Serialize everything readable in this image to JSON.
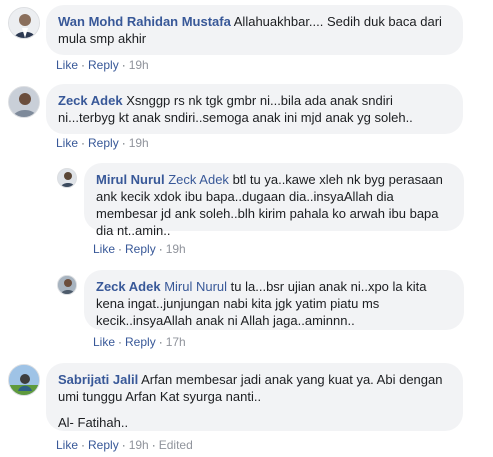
{
  "comments": [
    {
      "author": "Wan Mohd Rahidan Mustafa",
      "text": "Allahuakhbar.... Sedih duk baca dari mula smp akhir",
      "like": "Like",
      "reply": "Reply",
      "time": "19h"
    },
    {
      "author": "Zeck Adek",
      "text": "Xsnggp rs nk tgk gmbr ni...bila ada anak sndiri ni...terbyg kt anak sndiri..semoga anak ini mjd anak yg soleh..",
      "like": "Like",
      "reply": "Reply",
      "time": "19h"
    },
    {
      "author": "Mirul Nurul",
      "mention": "Zeck Adek",
      "text": "btl tu ya..kawe xleh nk byg perasaan ank kecik xdok ibu bapa..dugaan dia..insyaAllah dia membesar jd ank soleh..blh kirim pahala ko arwah ibu bapa dia nt..amin..",
      "like": "Like",
      "reply": "Reply",
      "time": "19h"
    },
    {
      "author": "Zeck Adek",
      "mention": "Mirul Nurul",
      "text": "tu la...bsr ujian anak ni..xpo la kita kena ingat..junjungan nabi kita jgk yatim piatu ms kecik..insyaAllah anak ni Allah jaga..aminnn..",
      "like": "Like",
      "reply": "Reply",
      "time": "17h"
    },
    {
      "author": "Sabrijati Jalil",
      "text": "Arfan membesar jadi anak yang kuat ya. Abi dengan umi tunggu Arfan Kat syurga nanti..",
      "text2": "Al- Fatihah..",
      "like": "Like",
      "reply": "Reply",
      "time": "19h",
      "edited": "Edited"
    }
  ]
}
